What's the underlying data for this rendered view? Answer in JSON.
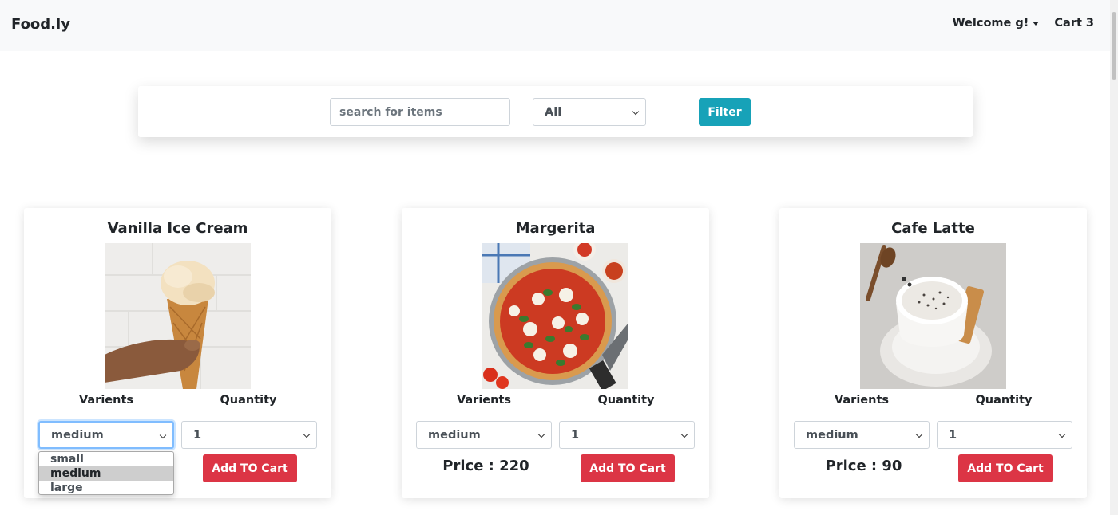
{
  "navbar": {
    "brand": "Food.ly",
    "welcome": "Welcome g!",
    "cart_label": "Cart",
    "cart_count": "3"
  },
  "filter": {
    "search_placeholder": "search for items",
    "category_value": "All",
    "filter_button": "Filter"
  },
  "labels": {
    "variants": "Varients",
    "quantity": "Quantity",
    "add_to_cart": "Add TO Cart"
  },
  "products": [
    {
      "name": "Vanilla Ice Cream",
      "variant": "medium",
      "quantity": "1",
      "price": "",
      "variant_options": [
        "small",
        "medium",
        "large"
      ]
    },
    {
      "name": "Margerita",
      "variant": "medium",
      "quantity": "1",
      "price": "Price : 220"
    },
    {
      "name": "Cafe Latte",
      "variant": "medium",
      "quantity": "1",
      "price": "Price : 90"
    }
  ],
  "colors": {
    "navbar_bg": "#f8f9fa",
    "filter_button": "#17a2b8",
    "add_button": "#dc3545"
  }
}
